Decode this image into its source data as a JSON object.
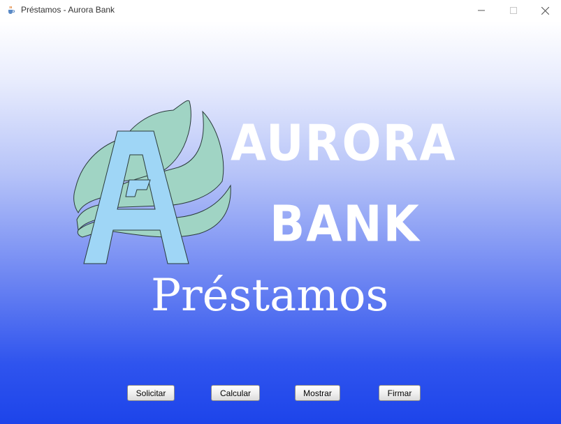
{
  "window": {
    "title": "Préstamos - Aurora Bank",
    "app_icon": "java-cup-icon",
    "controls": {
      "minimize_icon": "minimize-icon",
      "maximize_icon": "maximize-icon",
      "close_icon": "close-icon"
    }
  },
  "brand": {
    "line1": "AURORA",
    "line2": "BANK",
    "logo_letter": "A",
    "logo_colors": {
      "flame": "#a0d4c4",
      "letter": "#9fd6f6",
      "outline": "#2a3a3a"
    }
  },
  "section": {
    "title": "Préstamos"
  },
  "buttons": {
    "solicitar": "Solicitar",
    "calcular": "Calcular",
    "mostrar": "Mostrar",
    "firmar": "Firmar"
  },
  "colors": {
    "background_top": "#ffffff",
    "background_bottom": "#1d44ea",
    "text_on_background": "#ffffff"
  }
}
